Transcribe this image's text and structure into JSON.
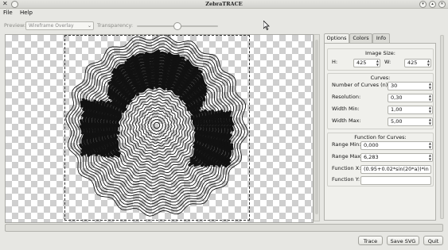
{
  "window": {
    "title": "ZebraTRACE",
    "app_icon": "x-icon",
    "controls": [
      "minimize-icon",
      "maximize-icon",
      "close-icon"
    ]
  },
  "menu": {
    "items": [
      "File",
      "Help"
    ]
  },
  "toolbar": {
    "preview_label": "Preview:",
    "preview_value": "Wireframe Overlay",
    "transparency_label": "Transparency:",
    "transparency_level": 0.5
  },
  "tabs": [
    "Options",
    "Colors",
    "Info"
  ],
  "active_tab": "Options",
  "image_size": {
    "title": "Image Size:",
    "h_label": "H:",
    "h_value": "425",
    "w_label": "W:",
    "w_value": "425"
  },
  "curves": {
    "title": "Curves:",
    "fields": [
      {
        "label": "Number of Curves (n):",
        "value": "30"
      },
      {
        "label": "Resolution:",
        "value": "0,30"
      },
      {
        "label": "Width Min:",
        "value": "1,00"
      },
      {
        "label": "Width Max:",
        "value": "5,00"
      }
    ]
  },
  "function": {
    "title": "Function for Curves:",
    "fields": [
      {
        "label": "Range Min:",
        "value": "0,000"
      },
      {
        "label": "Range Max:",
        "value": "6,283"
      },
      {
        "label": "Function X:",
        "value": "(0.95+0.02*sin(20*a))*in"
      },
      {
        "label": "Function Y:",
        "value": ""
      }
    ]
  },
  "buttons": {
    "trace": "Trace",
    "save_svg": "Save SVG",
    "quit": "Quit"
  },
  "colors": {
    "canvas_check": "#cfcfcf",
    "window_bg": "#e7e7e3"
  }
}
